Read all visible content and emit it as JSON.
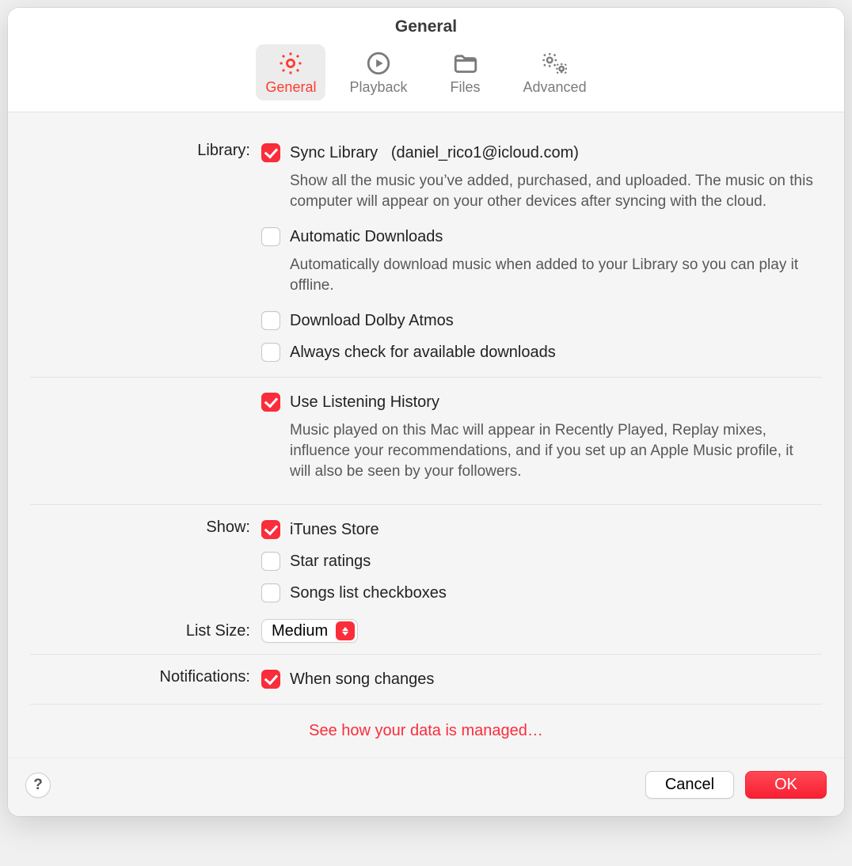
{
  "title": "General",
  "tabs": [
    {
      "id": "general",
      "label": "General",
      "active": true
    },
    {
      "id": "playback",
      "label": "Playback",
      "active": false
    },
    {
      "id": "files",
      "label": "Files",
      "active": false
    },
    {
      "id": "advanced",
      "label": "Advanced",
      "active": false
    }
  ],
  "sections": {
    "library": {
      "label": "Library:",
      "sync": {
        "label": "Sync Library",
        "suffix": "(daniel_rico1@icloud.com)",
        "checked": true,
        "desc": "Show all the music you’ve added, purchased, and uploaded. The music on this computer will appear on your other devices after syncing with the cloud."
      },
      "autodl": {
        "label": "Automatic Downloads",
        "checked": false,
        "desc": "Automatically download music when added to your Library so you can play it offline."
      },
      "dolby": {
        "label": "Download Dolby Atmos",
        "checked": false
      },
      "checkdl": {
        "label": "Always check for available downloads",
        "checked": false
      },
      "history": {
        "label": "Use Listening History",
        "checked": true,
        "desc": "Music played on this Mac will appear in Recently Played, Replay mixes, influence your recommendations, and if you set up an Apple Music profile, it will also be seen by your followers."
      }
    },
    "show": {
      "label": "Show:",
      "itunes": {
        "label": "iTunes Store",
        "checked": true
      },
      "stars": {
        "label": "Star ratings",
        "checked": false
      },
      "songcheck": {
        "label": "Songs list checkboxes",
        "checked": false
      }
    },
    "listsize": {
      "label": "List Size:",
      "value": "Medium"
    },
    "notifications": {
      "label": "Notifications:",
      "songchange": {
        "label": "When song changes",
        "checked": true
      }
    }
  },
  "data_link": "See how your data is managed…",
  "footer": {
    "help": "?",
    "cancel": "Cancel",
    "ok": "OK"
  }
}
